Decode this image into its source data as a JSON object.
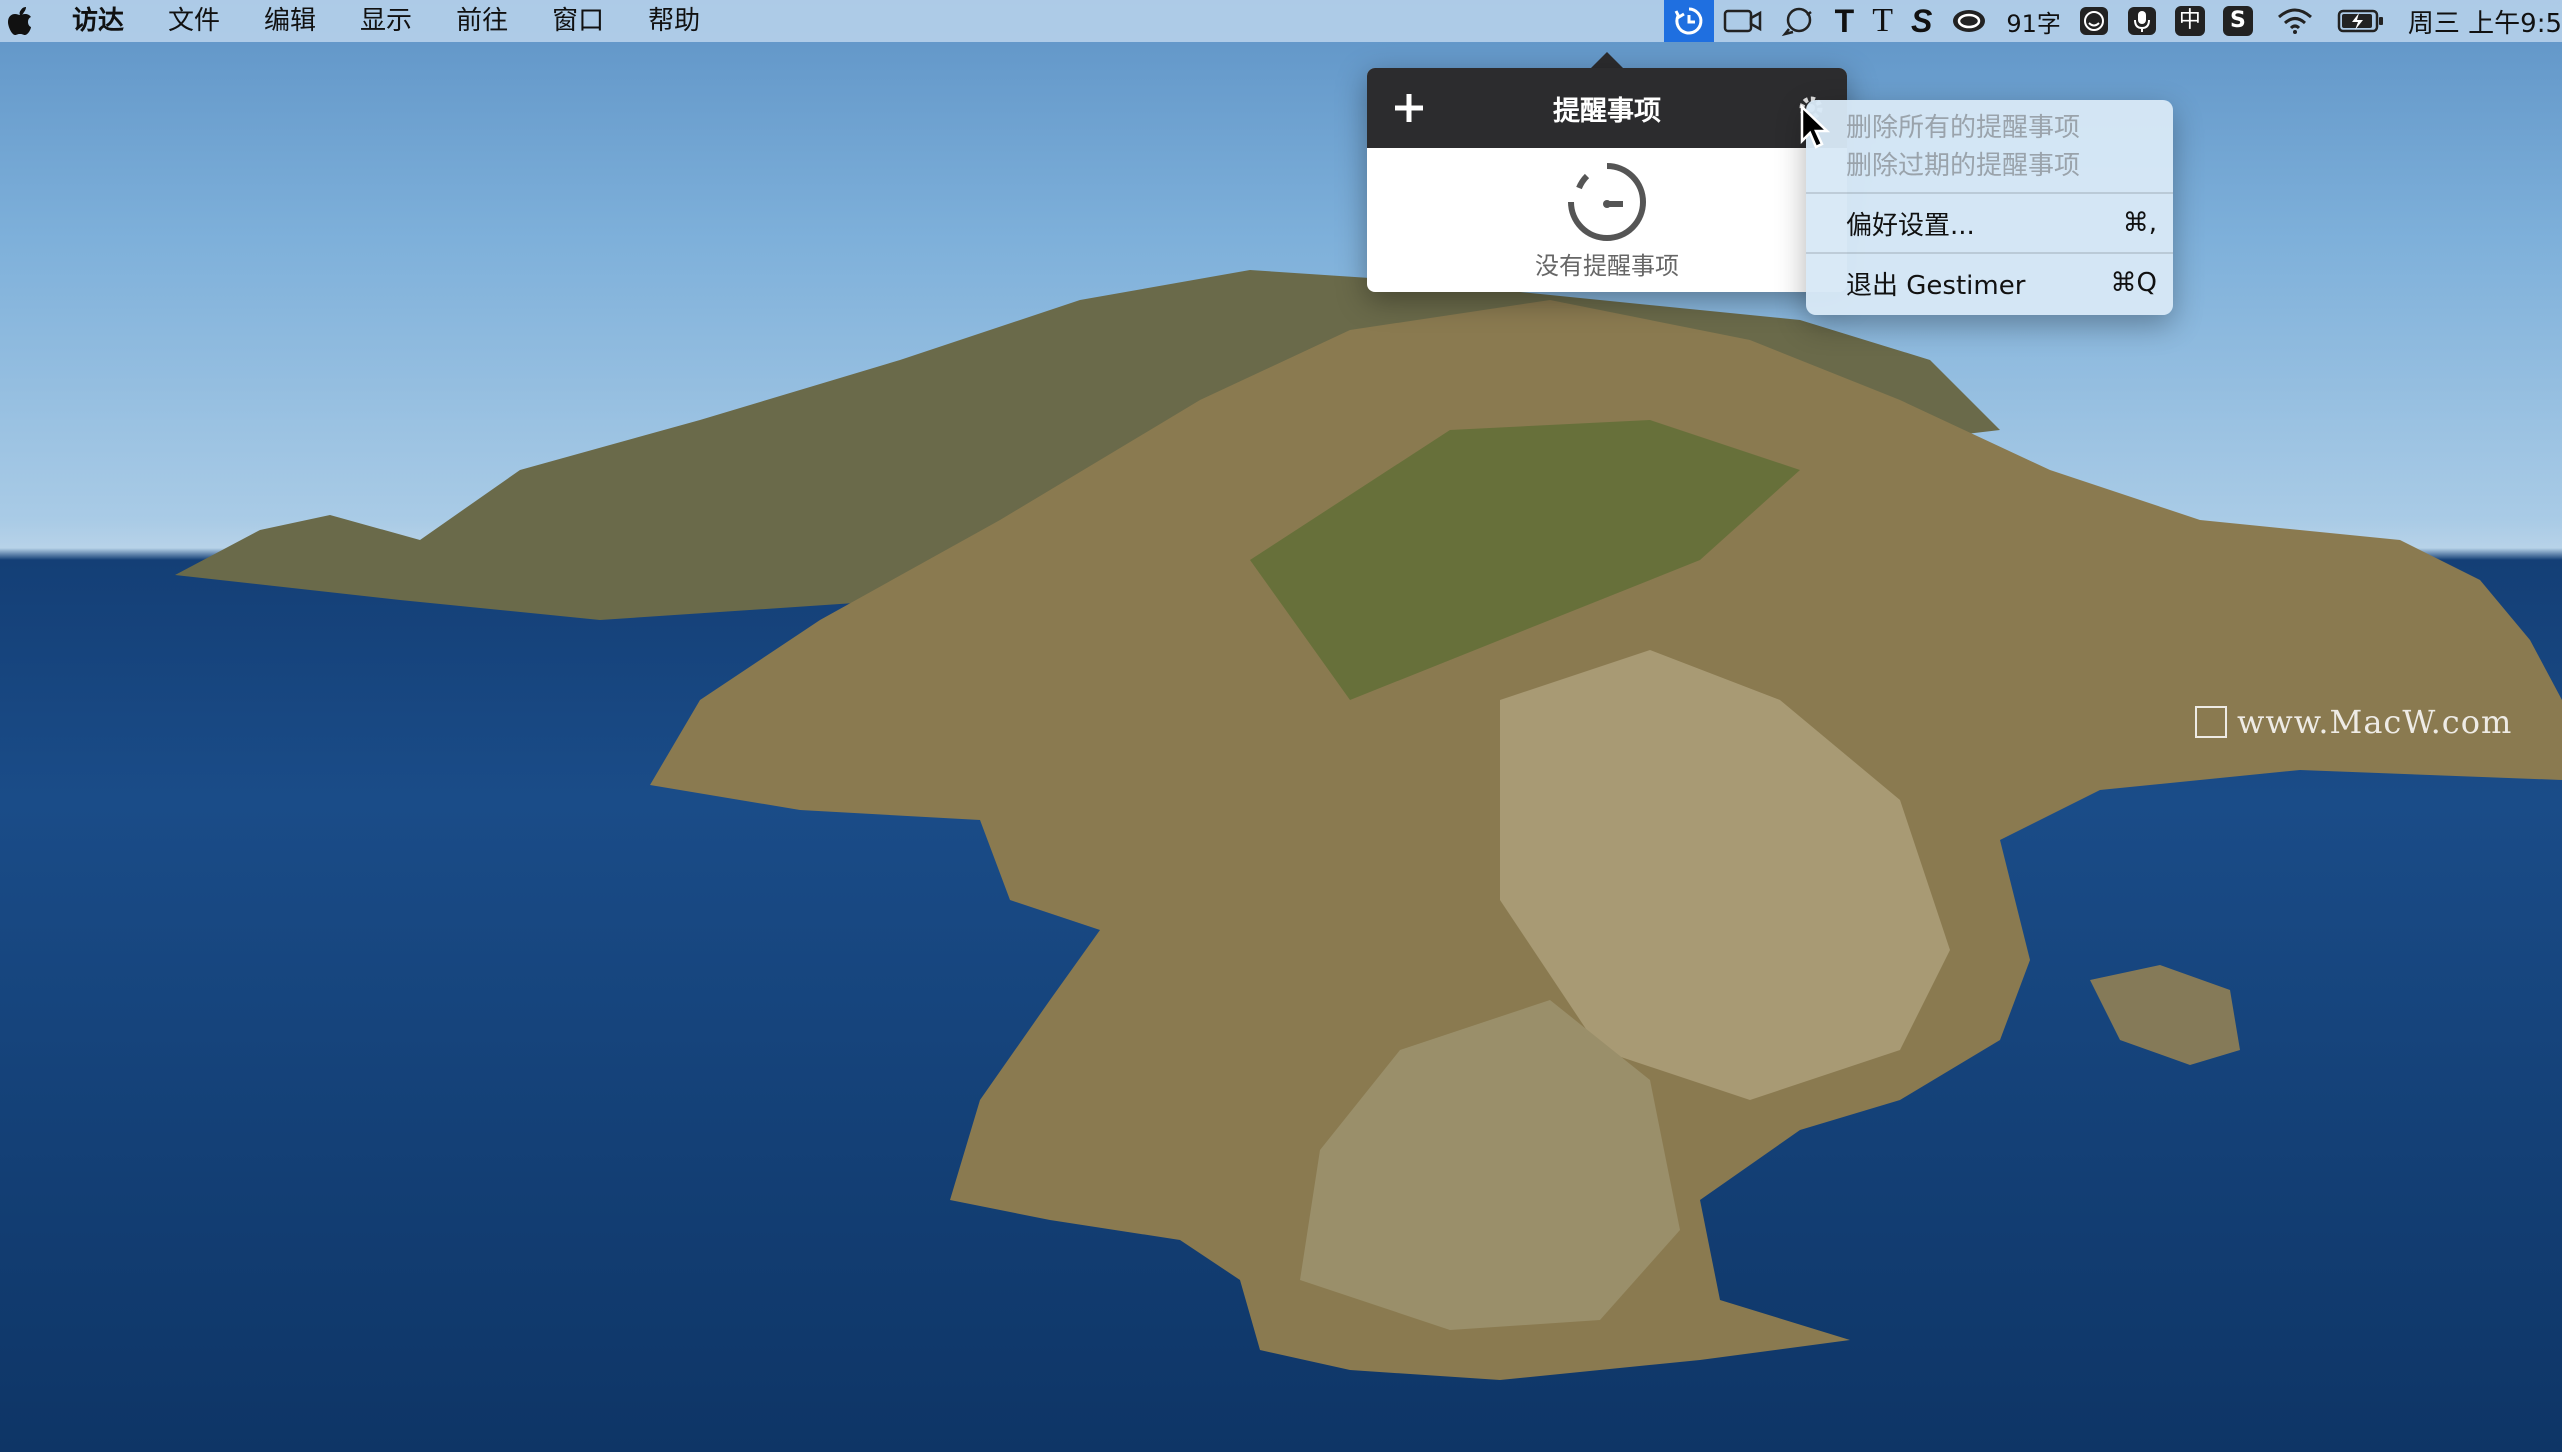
{
  "menubar": {
    "app_name": "访达",
    "menus": [
      "文件",
      "编辑",
      "显示",
      "前往",
      "窗口",
      "帮助"
    ],
    "tray_icons": [
      "gestimer-icon",
      "screen-record-icon",
      "chat-refresh-icon",
      "typeface-bold-icon",
      "typeface-serif-icon",
      "s-app-icon",
      "cloud-app-icon"
    ],
    "word_count": "91字",
    "ime_label": "中",
    "clock": "周三 上午9:5"
  },
  "popover": {
    "title": "提醒事项",
    "empty_text": "没有提醒事项"
  },
  "context_menu": {
    "delete_all": "删除所有的提醒事项",
    "delete_expired": "删除过期的提醒事项",
    "preferences": "偏好设置...",
    "preferences_shortcut": "⌘,",
    "quit": "退出 Gestimer",
    "quit_shortcut": "⌘Q"
  },
  "watermark": "www.MacW.com",
  "colors": {
    "active_tray": "#1f6fe0",
    "popover_header": "#2c2c2e"
  }
}
